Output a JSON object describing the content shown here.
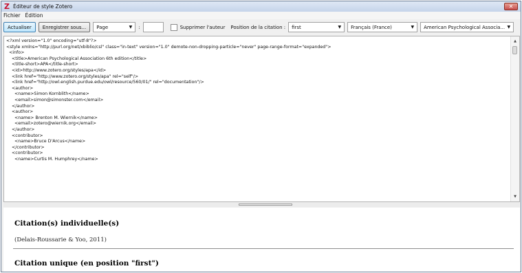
{
  "window": {
    "title": "Éditeur de style Zotero",
    "app_icon": "zotero-icon",
    "close_icon": "close-icon"
  },
  "menu": {
    "file": "Fichier",
    "edit": "Édition"
  },
  "toolbar": {
    "update_label": "Actualiser",
    "save_as_label": "Enregistrer sous...",
    "page_select_value": "Page",
    "colon": ":",
    "suppress_author_label": "Supprimer l'auteur",
    "position_label": "Position de la citation :",
    "position_value": "first",
    "locale_value": "Français (France)",
    "style_value": "American Psychological Associa..."
  },
  "editor": {
    "lines": [
      "<?xml version=\"1.0\" encoding=\"utf-8\"?>",
      "<style xmlns=\"http://purl.org/net/xbiblio/csl\" class=\"in-text\" version=\"1.0\" demote-non-dropping-particle=\"never\" page-range-format=\"expanded\">",
      "  <info>",
      "    <title>American Psychological Association 6th edition</title>",
      "    <title-short>APA</title-short>",
      "    <id>http://www.zotero.org/styles/apa</id>",
      "    <link href=\"http://www.zotero.org/styles/apa\" rel=\"self\"/>",
      "    <link href=\"http://owl.english.purdue.edu/owl/resource/560/01/\" rel=\"documentation\"/>",
      "    <author>",
      "      <name>Simon Kornblith</name>",
      "      <email>simon@simonster.com</email>",
      "    </author>",
      "    <author>",
      "      <name> Brenton M. Wiernik</name>",
      "      <email>zotero@wiernik.org</email>",
      "    </author>",
      "    <contributor>",
      "      <name>Bruce D'Arcus</name>",
      "    </contributor>",
      "    <contributor>",
      "      <name>Curtis M. Humphrey</name>"
    ]
  },
  "preview": {
    "individual_heading": "Citation(s) individuelle(s)",
    "individual_citation": "(Delais-Roussarie & Yoo, 2011)",
    "single_heading": "Citation unique (en position \"first\")"
  }
}
